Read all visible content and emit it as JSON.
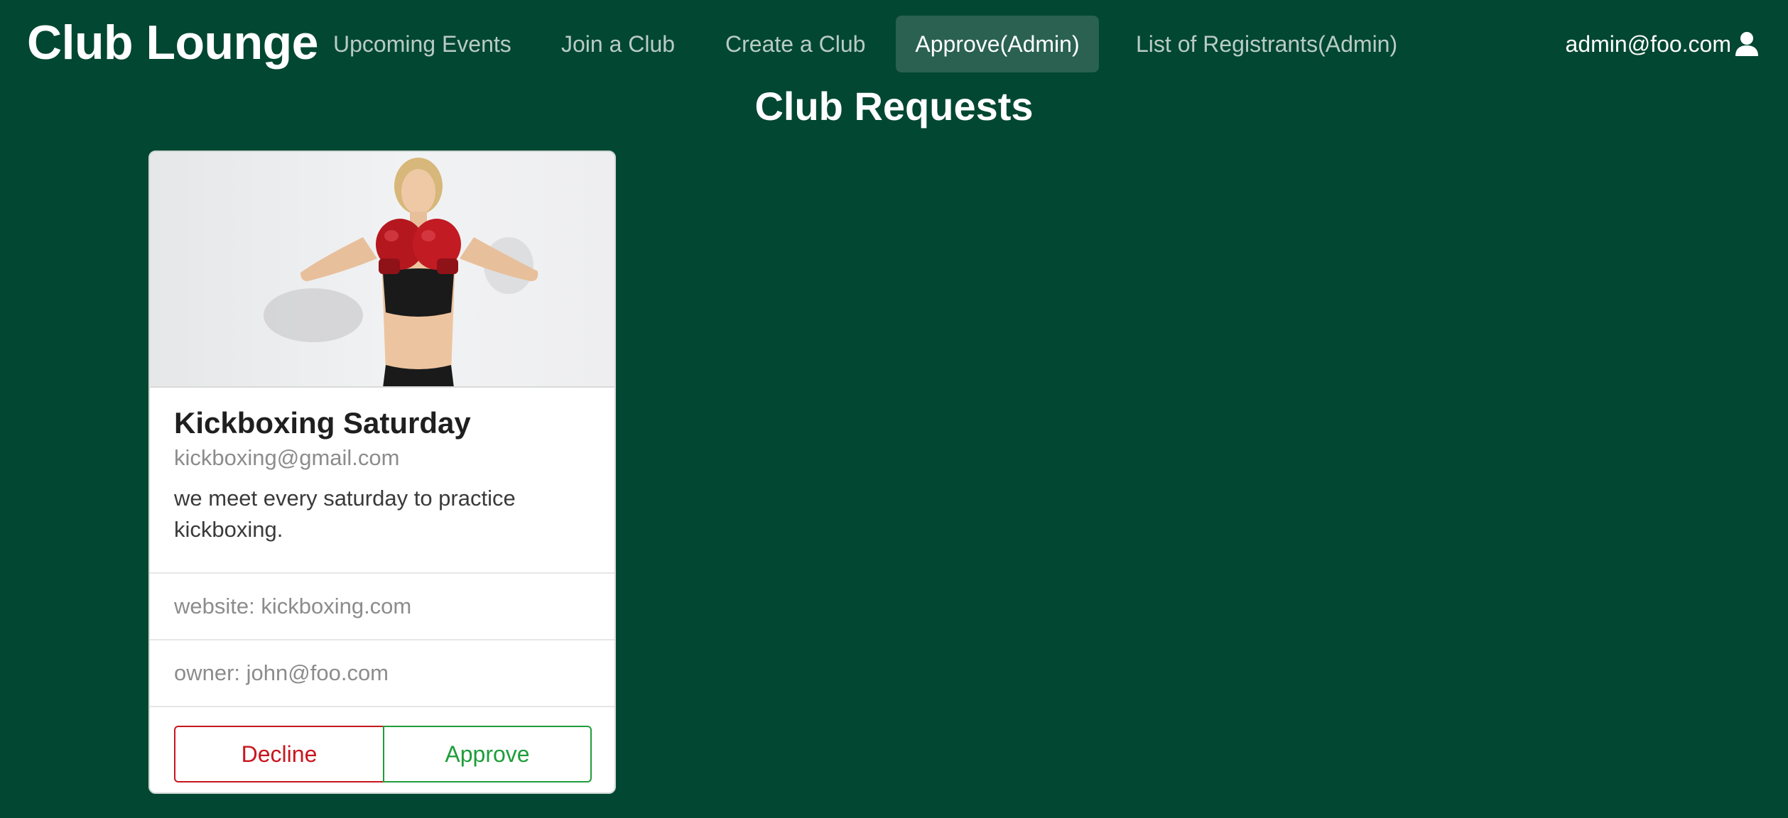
{
  "app": {
    "brand": "Club Lounge"
  },
  "nav": {
    "items": [
      {
        "label": "Upcoming Events"
      },
      {
        "label": "Join a Club"
      },
      {
        "label": "Create a Club"
      },
      {
        "label": "Approve(Admin)",
        "active": true
      },
      {
        "label": "List of Registrants(Admin)"
      }
    ],
    "user": {
      "email": "admin@foo.com",
      "icon": "user-icon"
    }
  },
  "page": {
    "title": "Club Requests"
  },
  "card": {
    "image": "kickboxing-photo",
    "title": "Kickboxing Saturday",
    "email": "kickboxing@gmail.com",
    "description": "we meet every saturday to practice kickboxing.",
    "website": "website: kickboxing.com",
    "owner": "owner: john@foo.com",
    "decline_label": "Decline",
    "approve_label": "Approve"
  },
  "colors": {
    "background": "#024731",
    "active_nav": "#2a6150",
    "decline": "#c8161d",
    "approve": "#1f9d3a"
  }
}
